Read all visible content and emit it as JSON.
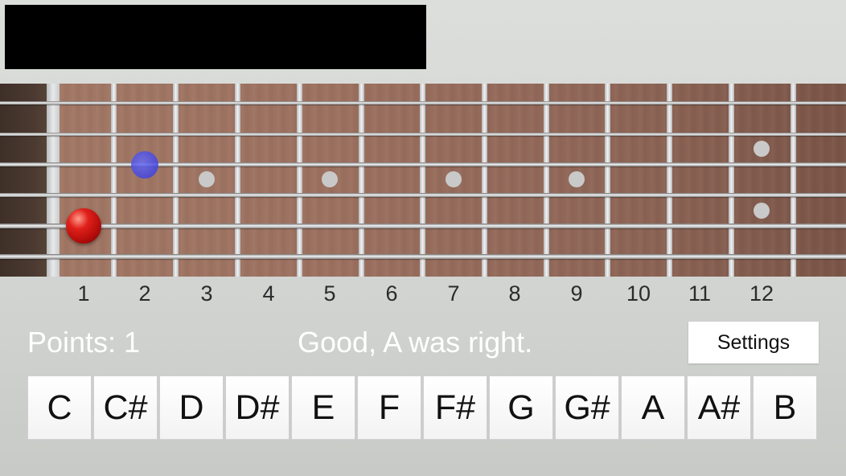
{
  "fret_numbers": [
    "1",
    "2",
    "3",
    "4",
    "5",
    "6",
    "7",
    "8",
    "9",
    "10",
    "11",
    "12"
  ],
  "status": {
    "points": "Points: 1",
    "feedback": "Good, A was right."
  },
  "settings": {
    "label": "Settings"
  },
  "notes": [
    "C",
    "C#",
    "D",
    "D#",
    "E",
    "F",
    "F#",
    "G",
    "G#",
    "A",
    "A#",
    "B"
  ],
  "colors": {
    "target_ball": "#d11a14",
    "highlight_dot": "#4a4ce6",
    "ad_banner": "#000000"
  }
}
